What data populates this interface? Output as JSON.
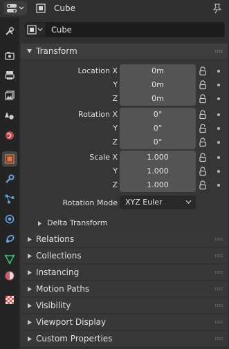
{
  "header": {
    "title": "Cube",
    "editor_icon": "properties-editor-icon",
    "object_icon": "object-cube-icon",
    "pin_icon": "pin-icon"
  },
  "object_bar": {
    "name": "Cube"
  },
  "tabs": [
    {
      "name": "tool",
      "icon": "tool-wrench-screwdriver-icon"
    },
    {
      "name": "render",
      "icon": "render-camera-icon"
    },
    {
      "name": "output",
      "icon": "output-printer-icon"
    },
    {
      "name": "view-layer",
      "icon": "view-layer-image-icon"
    },
    {
      "name": "scene",
      "icon": "scene-cone-sphere-icon"
    },
    {
      "name": "world",
      "icon": "world-globe-icon"
    },
    {
      "name": "object",
      "icon": "object-square-icon",
      "active": true
    },
    {
      "name": "modifiers",
      "icon": "modifier-wrench-icon"
    },
    {
      "name": "particles",
      "icon": "particles-icon"
    },
    {
      "name": "physics",
      "icon": "physics-orbit-icon"
    },
    {
      "name": "constraints",
      "icon": "object-constraint-icon"
    },
    {
      "name": "data",
      "icon": "mesh-data-triangle-icon"
    },
    {
      "name": "material",
      "icon": "material-sphere-icon"
    },
    {
      "name": "texture",
      "icon": "texture-checker-icon"
    }
  ],
  "transform": {
    "title": "Transform",
    "location": {
      "labels": [
        "Location X",
        "Y",
        "Z"
      ],
      "values": [
        "0m",
        "0m",
        "0m"
      ]
    },
    "rotation": {
      "labels": [
        "Rotation X",
        "Y",
        "Z"
      ],
      "values": [
        "0°",
        "0°",
        "0°"
      ]
    },
    "scale": {
      "labels": [
        "Scale X",
        "Y",
        "Z"
      ],
      "values": [
        "1.000",
        "1.000",
        "1.000"
      ]
    },
    "rotation_mode": {
      "label": "Rotation Mode",
      "value": "XYZ Euler"
    },
    "delta_transform": "Delta Transform"
  },
  "panels": [
    "Relations",
    "Collections",
    "Instancing",
    "Motion Paths",
    "Visibility",
    "Viewport Display",
    "Custom Properties"
  ],
  "colors": {
    "active_tab_accent": "#e8773c",
    "modifier_blue": "#6aa1e0",
    "data_green": "#35c07a",
    "material_red": "#d25a5a"
  }
}
